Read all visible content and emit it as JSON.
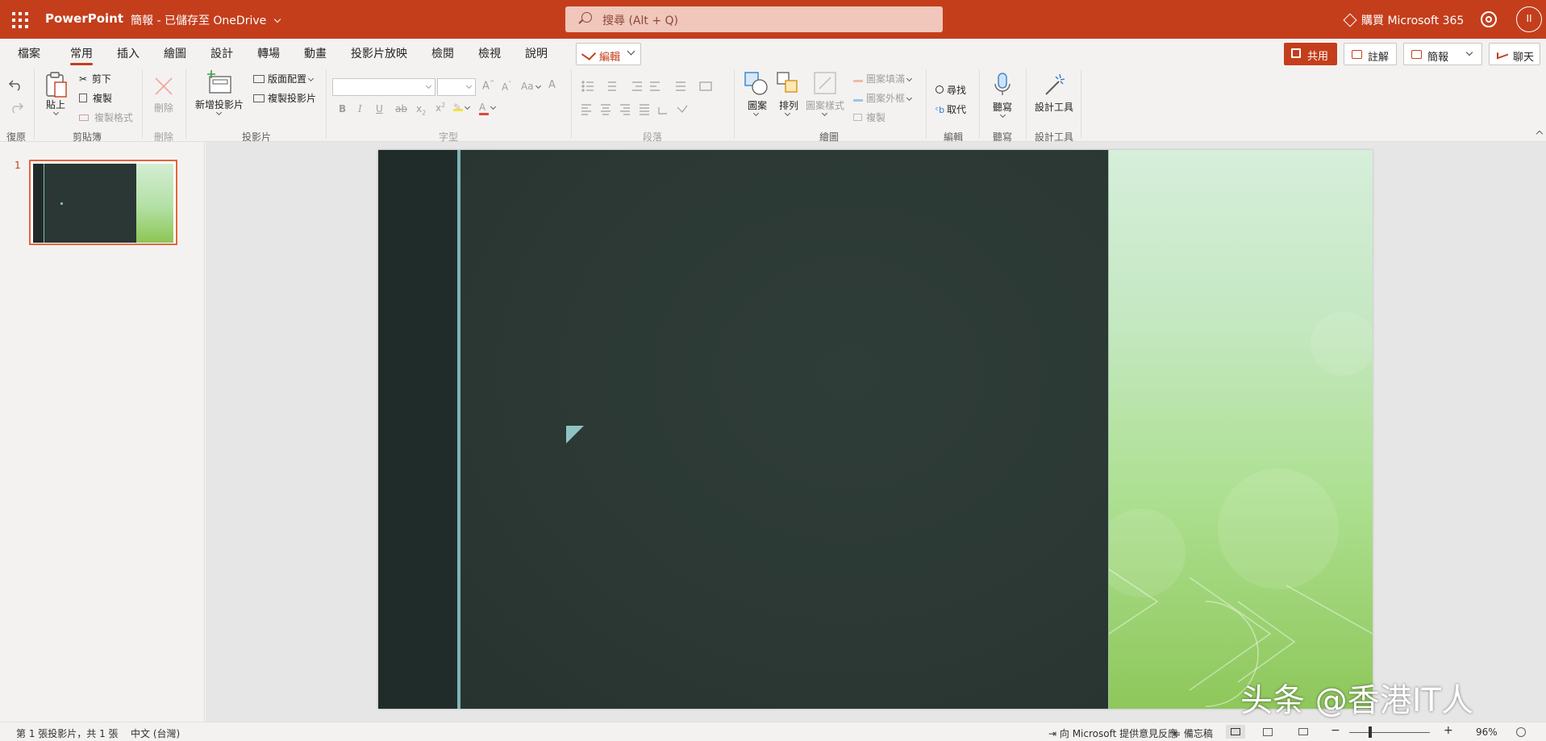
{
  "titlebar": {
    "app_name": "PowerPoint",
    "doc_title": "簡報 - 已儲存至 OneDrive",
    "search_placeholder": "搜尋 (Alt + Q)",
    "buy_label": "購買 Microsoft 365",
    "avatar_initials": "II"
  },
  "tabs": [
    "檔案",
    "常用",
    "插入",
    "繪圖",
    "設計",
    "轉場",
    "動畫",
    "投影片放映",
    "檢閱",
    "檢視",
    "說明"
  ],
  "active_tab": "常用",
  "edit_mode_label": "編輯",
  "header_buttons": {
    "share": "共用",
    "comments": "註解",
    "present": "簡報",
    "chat": "聊天"
  },
  "ribbon": {
    "undo_group": "復原",
    "clipboard": {
      "group": "剪貼簿",
      "paste": "貼上",
      "cut": "剪下",
      "copy": "複製",
      "format_painter": "複製格式"
    },
    "delete": {
      "group": "刪除",
      "delete": "刪除"
    },
    "slides": {
      "group": "投影片",
      "new_slide": "新增投影片",
      "layout": "版面配置",
      "duplicate": "複製投影片"
    },
    "font": {
      "group": "字型"
    },
    "paragraph": {
      "group": "段落"
    },
    "drawing": {
      "group": "繪圖",
      "shapes": "圖案",
      "arrange": "排列",
      "quick_styles": "圖案樣式",
      "shape_fill": "圖案填滿",
      "shape_outline": "圖案外框",
      "duplicate": "複製"
    },
    "editing": {
      "group": "編輯",
      "find": "尋找",
      "replace": "取代"
    },
    "dictate": {
      "group": "聽寫",
      "label": "聽寫"
    },
    "designer": {
      "group": "設計工具",
      "label": "設計工具"
    }
  },
  "thumbnails": [
    {
      "number": "1"
    }
  ],
  "watermark": "头条 @香港IT人",
  "statusbar": {
    "slide_info": "第 1 張投影片，共 1 張",
    "language": "中文 (台灣)",
    "feedback": "向 Microsoft 提供意見反應",
    "notes": "備忘稿",
    "zoom_minus": "−",
    "zoom_plus": "+",
    "zoom_level": "96%"
  },
  "colors": {
    "brand": "#c43e1c",
    "slide_dark": "#2b3a36",
    "slide_accent": "#7fb3b6",
    "slide_green": "#8ec75a"
  }
}
